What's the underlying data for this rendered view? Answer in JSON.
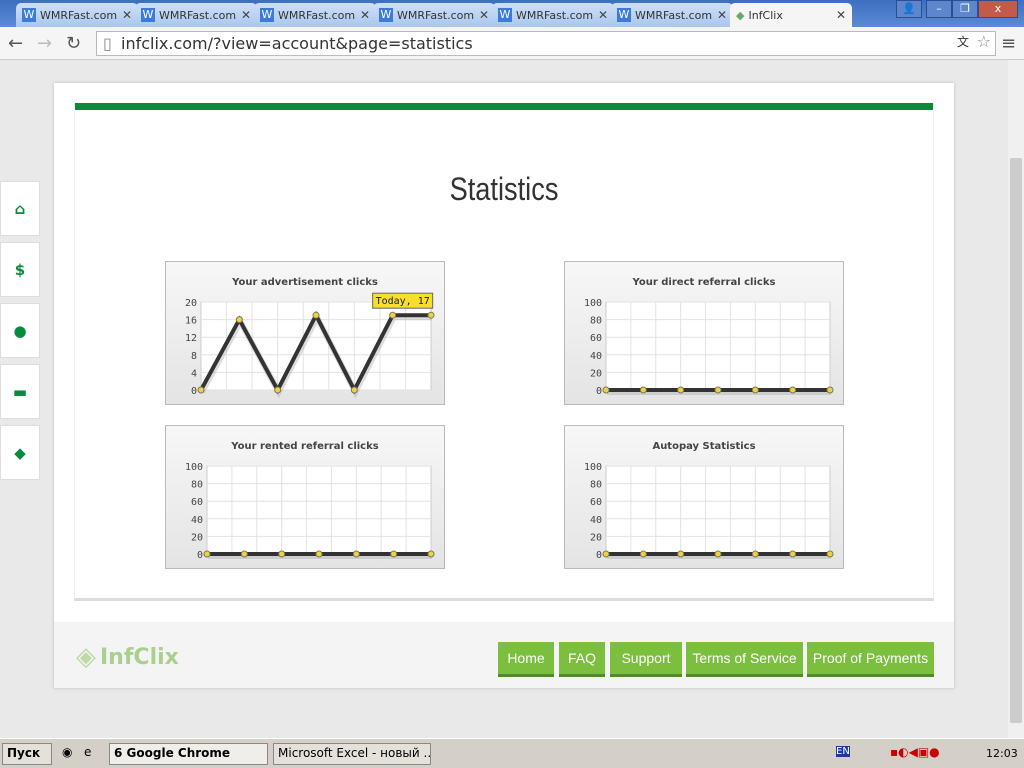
{
  "browser": {
    "tabs": [
      {
        "label": "WMRFast.com"
      },
      {
        "label": "WMRFast.com"
      },
      {
        "label": "WMRFast.com"
      },
      {
        "label": "WMRFast.com"
      },
      {
        "label": "WMRFast.com"
      },
      {
        "label": "WMRFast.com"
      },
      {
        "label": "InfClix"
      }
    ],
    "url": "infclix.com/?view=account&page=statistics"
  },
  "page": {
    "title": "Statistics"
  },
  "chart_data": [
    {
      "type": "line",
      "title": "Your advertisement clicks",
      "ylim": [
        0,
        20
      ],
      "yticks": [
        "20",
        "16",
        "12",
        "8",
        "4",
        "0"
      ],
      "values": [
        0,
        16,
        0,
        17,
        0,
        17,
        17
      ],
      "tooltip": "Today, 17"
    },
    {
      "type": "line",
      "title": "Your direct referral clicks",
      "ylim": [
        0,
        100
      ],
      "yticks": [
        "100",
        "80",
        "60",
        "40",
        "20",
        "0"
      ],
      "values": [
        0,
        0,
        0,
        0,
        0,
        0,
        0
      ]
    },
    {
      "type": "line",
      "title": "Your rented referral clicks",
      "ylim": [
        0,
        100
      ],
      "yticks": [
        "100",
        "80",
        "60",
        "40",
        "20",
        "0"
      ],
      "values": [
        0,
        0,
        0,
        0,
        0,
        0,
        0
      ]
    },
    {
      "type": "line",
      "title": "Autopay Statistics",
      "ylim": [
        0,
        100
      ],
      "yticks": [
        "100",
        "80",
        "60",
        "40",
        "20",
        "0"
      ],
      "values": [
        0,
        0,
        0,
        0,
        0,
        0,
        0
      ]
    }
  ],
  "footer": {
    "logo": "InfClix",
    "links": [
      "Home",
      "FAQ",
      "Support",
      "Terms of Service",
      "Proof of Payments"
    ]
  },
  "taskbar": {
    "start": "Пуск",
    "items": [
      "6 Google Chrome",
      "Microsoft Excel - новый ..."
    ],
    "lang": "EN",
    "clock": "12:03"
  },
  "colors": {
    "green": "#0a8a3c",
    "button": "#7cbf3f",
    "line": "#333333",
    "point": "#f2d13a"
  }
}
